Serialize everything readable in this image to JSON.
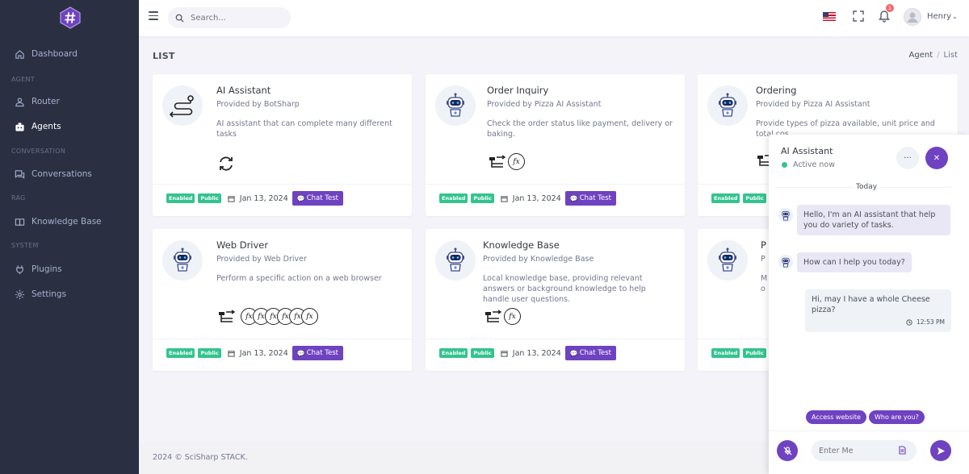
{
  "sidebar": {
    "items": [
      {
        "label": "Dashboard",
        "icon": "home-icon"
      },
      {
        "label": "Router",
        "icon": "router-icon"
      },
      {
        "label": "Agents",
        "icon": "agents-icon"
      },
      {
        "label": "Conversations",
        "icon": "conversations-icon"
      },
      {
        "label": "Knowledge Base",
        "icon": "book-icon"
      },
      {
        "label": "Plugins",
        "icon": "plug-icon"
      },
      {
        "label": "Settings",
        "icon": "gear-icon"
      }
    ],
    "sections": [
      "AGENT",
      "CONVERSATION",
      "RAG",
      "SYSTEM"
    ]
  },
  "topbar": {
    "search_placeholder": "Search...",
    "notification_count": "1",
    "user_name": "Henry"
  },
  "page": {
    "title": "LIST",
    "breadcrumb": [
      "Agent",
      "List"
    ]
  },
  "cards": [
    {
      "name": "AI Assistant",
      "provider": "Provided by BotSharp",
      "desc": "AI assistant that can complete many different tasks",
      "badges": [
        "Enabled",
        "Public"
      ],
      "date": "Jan 13, 2024",
      "button": "Chat Test"
    },
    {
      "name": "Order Inquiry",
      "provider": "Provided by Pizza AI Assistant",
      "desc": "Check the order status like payment, delivery or baking.",
      "badges": [
        "Enabled",
        "Public"
      ],
      "date": "Jan 13, 2024",
      "button": "Chat Test"
    },
    {
      "name": "Ordering",
      "provider": "Provided by Pizza AI Assistant",
      "desc": "Provide types of pizza available, unit price and total cos",
      "badges": [
        "Enabled",
        "Public"
      ],
      "date": "Jan 13, 2024",
      "button": "Chat Test"
    },
    {
      "name": "Web Driver",
      "provider": "Provided by Web Driver",
      "desc": "Perform a specific action on a web browser",
      "badges": [
        "Enabled",
        "Public"
      ],
      "date": "Jan 13, 2024",
      "button": "Chat Test"
    },
    {
      "name": "Knowledge Base",
      "provider": "Provided by Knowledge Base",
      "desc": "Local knowledge base, providing relevant answers or background knowledge to help handle user questions.",
      "badges": [
        "Enabled",
        "Public"
      ],
      "date": "Jan 13, 2024",
      "button": "Chat Test"
    },
    {
      "name": "P",
      "provider": "P",
      "desc": "M o",
      "badges": [
        "Enabled",
        "Public"
      ],
      "date": "",
      "button": ""
    }
  ],
  "fx_label": "fx",
  "footer": {
    "text": "2024 © SciSharp STACK."
  },
  "chat": {
    "title": "AI Assistant",
    "status": "Active now",
    "day_label": "Today",
    "messages": [
      {
        "text": "Hello, I'm an AI assistant that help you do variety of tasks.",
        "from": "bot"
      },
      {
        "text": "How can I help you today?",
        "from": "bot"
      },
      {
        "text": "Hi, may I have a whole Cheese pizza?",
        "from": "user",
        "time": "12:53 PM"
      }
    ],
    "suggestions": [
      "Access website",
      "Who are you?"
    ],
    "input_placeholder": "Enter Me"
  },
  "colors": {
    "accent": "#6f42c1",
    "success": "#34c38f",
    "sidebar": "#2a3042"
  }
}
